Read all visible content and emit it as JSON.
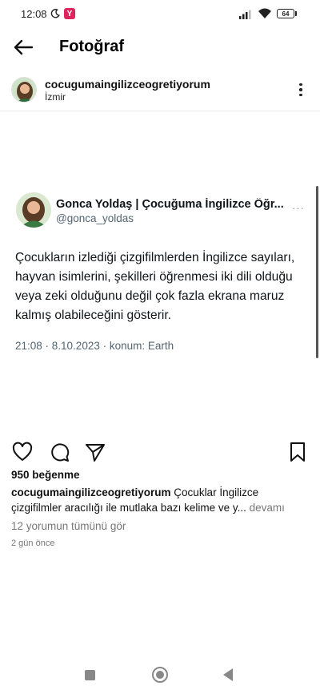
{
  "status_bar": {
    "time": "12:08",
    "app_badge": "Y",
    "battery": "64",
    "icons": [
      "moon-icon",
      "signal-icon",
      "wifi-icon",
      "battery-icon"
    ]
  },
  "header": {
    "title": "Fotoğraf",
    "back_icon": "arrow-left-icon"
  },
  "post": {
    "username": "cocugumaingilizceogretiyorum",
    "location": "İzmir",
    "more_icon": "more-vertical-icon"
  },
  "tweet": {
    "display_name": "Gonca Yoldaş | Çocuğuma İngilizce Öğr...",
    "handle": "@gonca_yoldas",
    "more": "···",
    "text": "Çocukların izlediği çizgifilmlerden İngilizce sayıları, hayvan isimlerini, şekilleri öğrenmesi iki dili olduğu veya zeki olduğunu değil çok fazla ekrana maruz kalmış olabileceğini gösterir.",
    "meta": "21:08 · 8.10.2023 · konum: Earth"
  },
  "actions": {
    "icons": [
      "heart-icon",
      "comment-icon",
      "share-icon",
      "bookmark-icon"
    ]
  },
  "engagement": {
    "likes": "950 beğenme",
    "caption_user": "cocugumaingilizceogretiyorum",
    "caption_text": " Çocuklar İngilizce çizgifilmler aracılığı ile mutlaka bazı kelime ve y...",
    "caption_more": " devamı",
    "comments_link": "12 yorumun tümünü gör",
    "time_ago": "2 gün önce"
  },
  "nav_bar": {
    "icons": [
      "recents-square-icon",
      "home-circle-icon",
      "back-triangle-icon"
    ]
  },
  "colors": {
    "accent_badge": "#e0245e",
    "tweet_secondary": "#536471",
    "muted": "#777777"
  }
}
